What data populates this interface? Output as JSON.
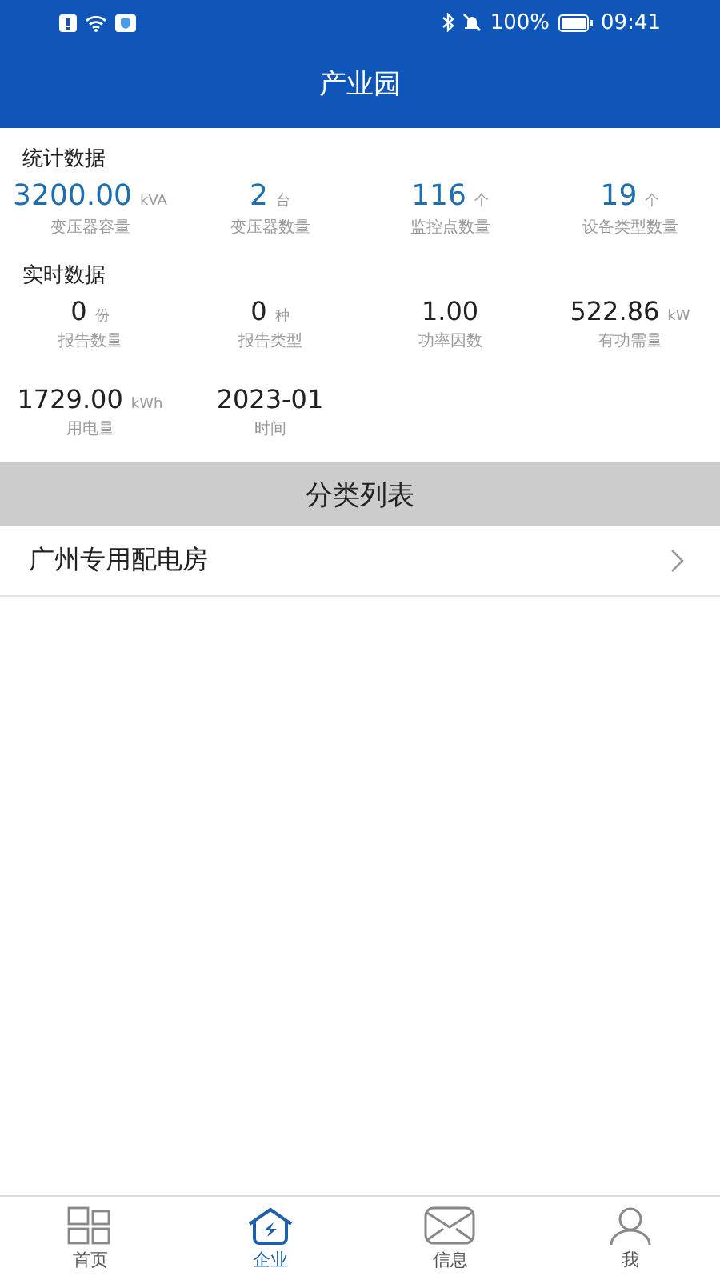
{
  "status_bar": {
    "battery": "100%",
    "time": "09:41"
  },
  "header": {
    "title": "产业园"
  },
  "sections": [
    {
      "title": "统计数据",
      "kind": "stat",
      "items": [
        {
          "value": "3200.00",
          "unit": "kVA",
          "label": "变压器容量"
        },
        {
          "value": "2",
          "unit": "台",
          "label": "变压器数量"
        },
        {
          "value": "116",
          "unit": "个",
          "label": "监控点数量"
        },
        {
          "value": "19",
          "unit": "个",
          "label": "设备类型数量"
        }
      ]
    },
    {
      "title": "实时数据",
      "kind": "realtime",
      "items": [
        {
          "value": "0",
          "unit": "份",
          "label": "报告数量"
        },
        {
          "value": "0",
          "unit": "种",
          "label": "报告类型"
        },
        {
          "value": "1.00",
          "label": "功率因数"
        },
        {
          "value": "522.86",
          "unit": "kW",
          "label": "有功需量"
        },
        {
          "value": "1729.00",
          "unit": "kWh",
          "label": "用电量"
        },
        {
          "value": "2023-01",
          "label": "时间"
        }
      ]
    }
  ],
  "category_list": {
    "title": "分类列表",
    "items": [
      "广州专用配电房"
    ]
  },
  "tabs": [
    {
      "label": "首页",
      "kind": "home",
      "selected": false
    },
    {
      "label": "企业",
      "kind": "company",
      "selected": true
    },
    {
      "label": "信息",
      "kind": "messages",
      "selected": false
    },
    {
      "label": "我",
      "kind": "profile",
      "selected": false
    }
  ]
}
